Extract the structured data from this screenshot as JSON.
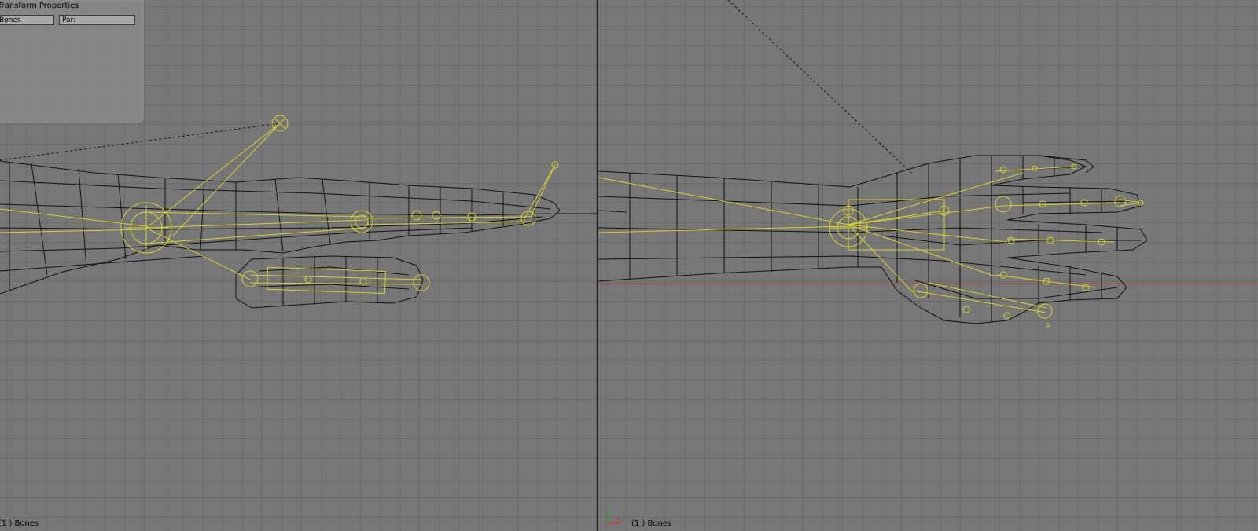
{
  "left_viewport": {
    "label": "(1 ) Bones",
    "panel": {
      "title": "Transform Properties",
      "object_field": "Bones",
      "parent_field": "Par:"
    }
  },
  "right_viewport": {
    "label": "(1 ) Bones",
    "axis": {
      "x_label": "x"
    }
  },
  "colors": {
    "background": "#777777",
    "grid": "#6b6b6b",
    "wireframe": "#000000",
    "bones_selected": "#d6d22e",
    "axis_x": "#c83c3c",
    "axis_y": "#2ea02e"
  }
}
